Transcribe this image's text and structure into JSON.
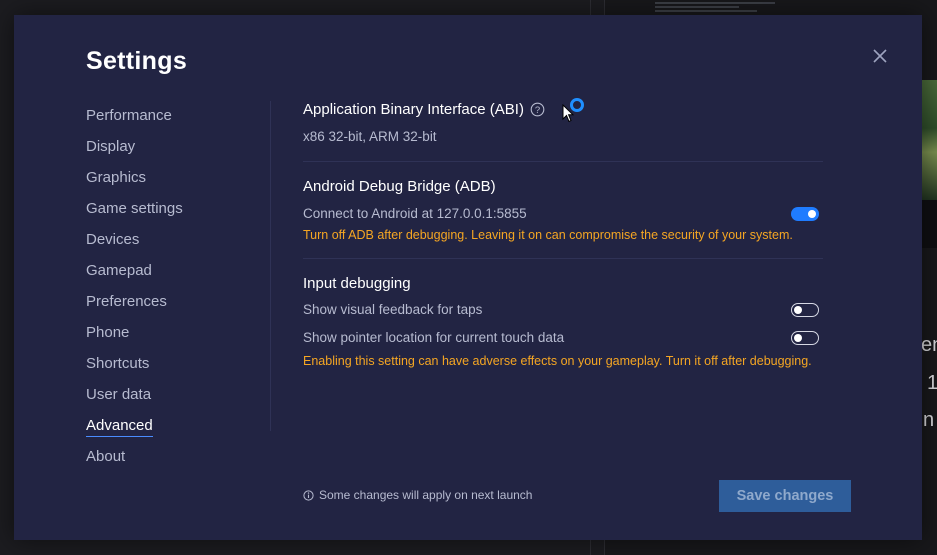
{
  "background": {
    "right_text_lines": [
      "en",
      "1",
      "n"
    ]
  },
  "dialog": {
    "title": "Settings",
    "close_icon": "close-icon"
  },
  "nav": {
    "items": [
      {
        "label": "Performance"
      },
      {
        "label": "Display"
      },
      {
        "label": "Graphics"
      },
      {
        "label": "Game settings"
      },
      {
        "label": "Devices"
      },
      {
        "label": "Gamepad"
      },
      {
        "label": "Preferences"
      },
      {
        "label": "Phone"
      },
      {
        "label": "Shortcuts"
      },
      {
        "label": "User data"
      },
      {
        "label": "Advanced"
      },
      {
        "label": "About"
      }
    ],
    "active": "Advanced"
  },
  "abi": {
    "title": "Application Binary Interface (ABI)",
    "value": "x86 32-bit, ARM 32-bit"
  },
  "adb": {
    "title": "Android Debug Bridge (ADB)",
    "connect_label": "Connect to Android at 127.0.0.1:5855",
    "connect_enabled": true,
    "warning": "Turn off ADB after debugging. Leaving it on can compromise the security of your system."
  },
  "input_debugging": {
    "title": "Input debugging",
    "options": [
      {
        "label": "Show visual feedback for taps",
        "enabled": false
      },
      {
        "label": "Show pointer location for current touch data",
        "enabled": false
      }
    ],
    "warning": "Enabling this setting can have adverse effects on your gameplay. Turn it off after debugging."
  },
  "footer": {
    "note": "Some changes will apply on next launch",
    "save_label": "Save changes"
  },
  "colors": {
    "dialog_bg": "#222443",
    "accent": "#1f7cff",
    "warning": "#f5a623",
    "save_button": "#2e5d9a"
  }
}
